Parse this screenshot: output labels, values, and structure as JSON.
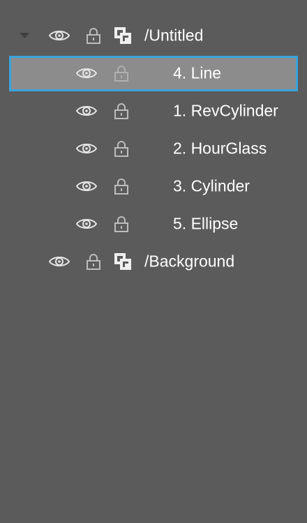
{
  "layers": {
    "group": {
      "name": "/Untitled",
      "expanded": true,
      "icons": {
        "expander": "caret-down-icon",
        "visibility": "eye-icon",
        "lock": "lock-icon",
        "type": "layer-group-icon"
      },
      "children": [
        {
          "name": "4. Line",
          "selected": true
        },
        {
          "name": "1. RevCylinder",
          "selected": false
        },
        {
          "name": "2. HourGlass",
          "selected": false
        },
        {
          "name": "3. Cylinder",
          "selected": false
        },
        {
          "name": "5. Ellipse",
          "selected": false
        }
      ]
    },
    "background": {
      "name": "/Background"
    }
  },
  "colors": {
    "panel_background": "#5b5b5b",
    "selected_row_fill": "#8c8c8c",
    "selection_border": "#3aa3dc",
    "text": "#ffffff",
    "icon": "#e6e6e6",
    "dim_icon": "#bdbdbd"
  }
}
